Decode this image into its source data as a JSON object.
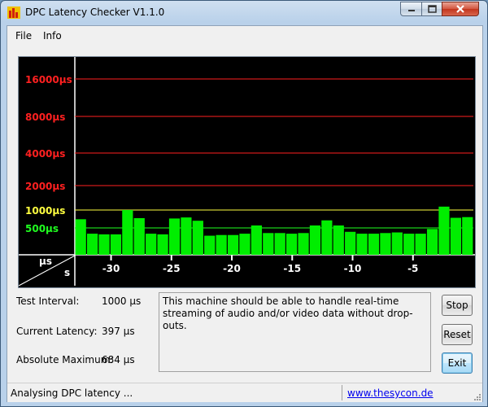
{
  "window": {
    "title": "DPC Latency Checker V1.1.0"
  },
  "menu": [
    {
      "label": "File"
    },
    {
      "label": "Info"
    }
  ],
  "chart_data": {
    "type": "bar",
    "ylabels": [
      {
        "text": "16000µs",
        "color": "#ff2020"
      },
      {
        "text": "8000µs",
        "color": "#ff2020"
      },
      {
        "text": "4000µs",
        "color": "#ff2020"
      },
      {
        "text": "2000µs",
        "color": "#ff2020"
      },
      {
        "text": "1000µs",
        "color": "#ffff40"
      },
      {
        "text": "500µs",
        "color": "#20ff20"
      }
    ],
    "unit_top": "µs",
    "unit_bottom": "s",
    "xticks": [
      "-30",
      "-25",
      "-20",
      "-15",
      "-10",
      "-5"
    ],
    "x_range": [
      -33,
      0
    ],
    "values": [
      700,
      400,
      390,
      390,
      1000,
      730,
      400,
      390,
      720,
      750,
      660,
      370,
      380,
      380,
      400,
      550,
      410,
      410,
      400,
      410,
      550,
      670,
      550,
      430,
      400,
      400,
      410,
      420,
      400,
      400,
      480,
      1140,
      740,
      760
    ],
    "bar_color": "#00ee00"
  },
  "info": {
    "test_interval_label": "Test Interval:",
    "test_interval_value": "1000 µs",
    "current_latency_label": "Current Latency:",
    "current_latency_value": "397 µs",
    "absolute_maximum_label": "Absolute Maximum:",
    "absolute_maximum_value": "684 µs"
  },
  "message": "This machine should be able to handle real-time streaming of audio and/or video data without drop-outs.",
  "buttons": {
    "stop": "Stop",
    "reset": "Reset",
    "exit": "Exit"
  },
  "status": {
    "text": "Analysing DPC latency ...",
    "link": "www.thesycon.de"
  }
}
